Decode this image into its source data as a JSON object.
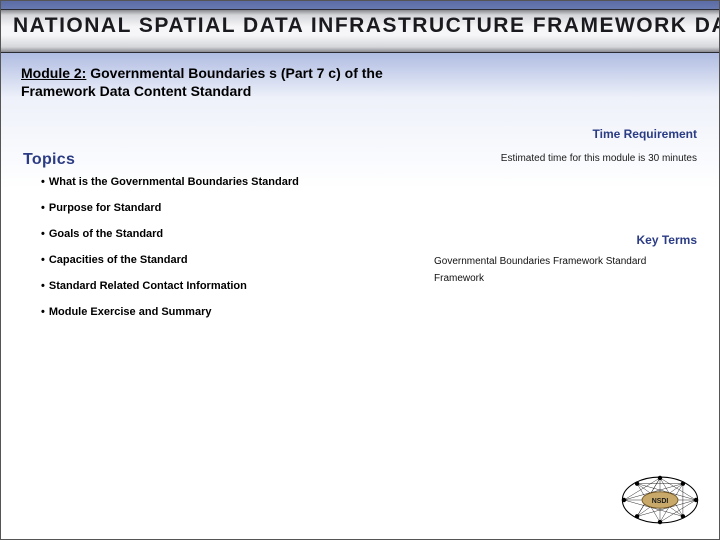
{
  "header": {
    "title": "NATIONAL SPATIAL DATA INFRASTRUCTURE FRAMEWORK DATA"
  },
  "module_title": {
    "underlined": "Module 2:",
    "rest_line1": " Governmental Boundaries s (Part 7 c) of the",
    "line2": "Framework Data Content Standard"
  },
  "time_requirement": {
    "heading": "Time Requirement",
    "text": "Estimated time for this module is 30 minutes"
  },
  "topics": {
    "heading": "Topics",
    "items": [
      "What is the Governmental Boundaries Standard",
      "Purpose for Standard",
      "Goals of the Standard",
      "Capacities of the Standard",
      "Standard Related Contact Information",
      "Module Exercise and Summary"
    ]
  },
  "key_terms": {
    "heading": "Key Terms",
    "items": [
      "Governmental Boundaries Framework Standard",
      "Framework"
    ]
  },
  "logo": {
    "label": "NSDI"
  }
}
